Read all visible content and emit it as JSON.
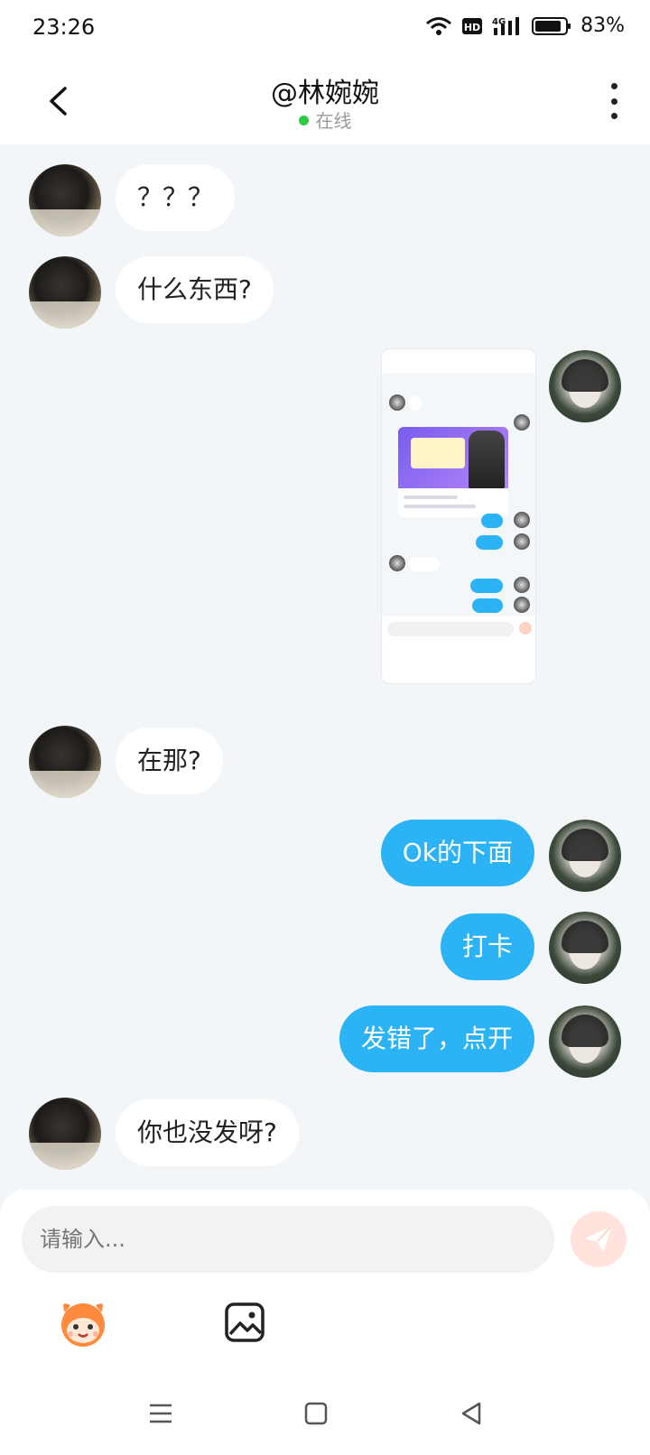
{
  "status_bar": {
    "time": "23:26",
    "battery": "83%",
    "hd_label": "HD",
    "network_label": "4G"
  },
  "header": {
    "title": "@林婉婉",
    "status": "在线"
  },
  "messages": [
    {
      "side": "in",
      "text": "？？？"
    },
    {
      "side": "in",
      "text": "什么东西?"
    },
    {
      "side": "out",
      "type": "image"
    },
    {
      "side": "in",
      "text": "在那?"
    },
    {
      "side": "out",
      "text": "Ok的下面"
    },
    {
      "side": "out",
      "text": "打卡"
    },
    {
      "side": "out",
      "text": "发错了，点开"
    },
    {
      "side": "in",
      "text": "你也没发呀?"
    }
  ],
  "composer": {
    "placeholder": "请输入..."
  },
  "colors": {
    "accent": "#2bb3f5",
    "online": "#2dcc46",
    "send_disabled": "#ffe3dc"
  }
}
